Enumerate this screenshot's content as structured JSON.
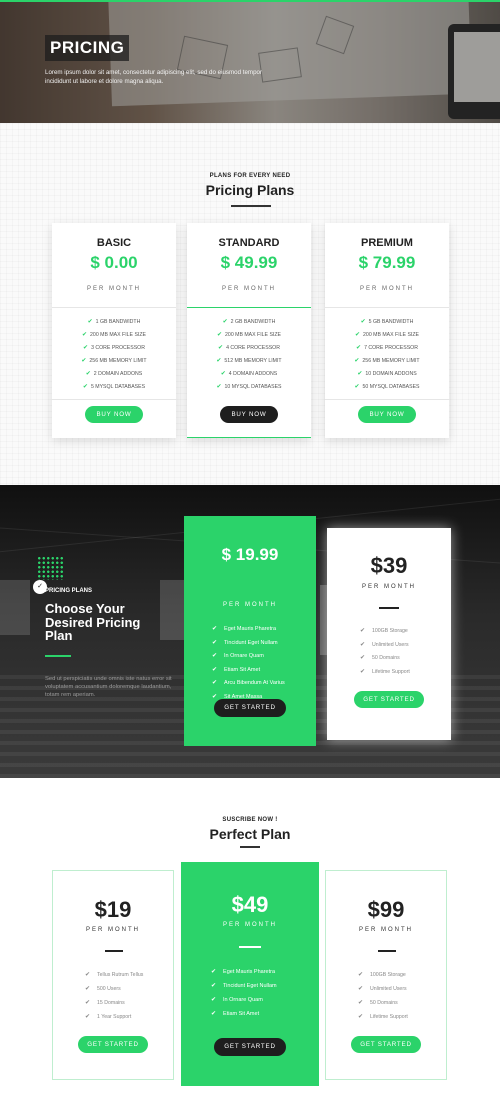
{
  "colors": {
    "accent": "#2bd36a",
    "dark": "#1e1e1e"
  },
  "hero": {
    "title": "PRICING",
    "subtitle": "Lorem ipsum dolor sit amet, consectetur adipiscing elit, sed do eiusmod tempor incididunt ut labore et dolore magna aliqua."
  },
  "section1": {
    "kicker": "PLANS FOR EVERY NEED",
    "title": "Pricing Plans",
    "plans": [
      {
        "name": "BASIC",
        "price": "$ 0.00",
        "period": "PER MONTH",
        "features": [
          "1 GB BANDWIDTH",
          "200 MB MAX FILE SIZE",
          "3 CORE PROCESSOR",
          "256 MB MEMORY LIMIT",
          "2 DOMAIN ADDONS",
          "5 MYSQL DATABASES"
        ],
        "button": "BUY NOW"
      },
      {
        "name": "STANDARD",
        "price": "$ 49.99",
        "period": "PER MONTH",
        "features": [
          "2 GB BANDWIDTH",
          "200 MB MAX FILE SIZE",
          "4 CORE PROCESSOR",
          "512 MB MEMORY LIMIT",
          "4 DOMAIN ADDONS",
          "10 MYSQL DATABASES"
        ],
        "button": "BUY NOW"
      },
      {
        "name": "PREMIUM",
        "price": "$ 79.99",
        "period": "PER MONTH",
        "features": [
          "5 GB BANDWIDTH",
          "200 MB MAX FILE SIZE",
          "7 CORE PROCESSOR",
          "256 MB MEMORY LIMIT",
          "10 DOMAIN ADDONS",
          "50 MYSQL DATABASES"
        ],
        "button": "BUY NOW"
      }
    ]
  },
  "section2": {
    "kicker": "PRICING PLANS",
    "circle_glyph": "✓",
    "title": "Choose Your Desired Pricing Plan",
    "text": "Sed ut perspiciatis unde omnis iste natus error sit voluptatem accusantium doloremque laudantium, totam rem aperiam.",
    "green_plan": {
      "price": "$ 19.99",
      "period": "PER MONTH",
      "features": [
        "Eget Mauris Pharetra",
        "Tincidunt Eget Nullam",
        "In Ornare Quam",
        "Etiam Sit Amet",
        "Arcu Bibendum At Varius",
        "Sit Amet Massa"
      ],
      "button": "GET STARTED"
    },
    "white_plan": {
      "price": "$39",
      "period": "PER MONTH",
      "features": [
        "100GB Storage",
        "Unlimited Users",
        "50 Domains",
        "Lifetime Support"
      ],
      "button": "GET STARTED"
    }
  },
  "section3": {
    "kicker": "SUSCRIBE NOW !",
    "title": "Perfect Plan",
    "plans": [
      {
        "price": "$19",
        "period": "PER MONTH",
        "features": [
          "Tellus Rutrum Tellus",
          "500 Users",
          "15 Domains",
          "1 Year Support"
        ],
        "button": "GET STARTED"
      },
      {
        "price": "$49",
        "period": "PER MONTH",
        "features": [
          "Eget Mauris Pharetra",
          "Tincidunt Eget Nullam",
          "In Ornare Quam",
          "Etiam Sit Amet"
        ],
        "button": "GET STARTED"
      },
      {
        "price": "$99",
        "period": "PER MONTH",
        "features": [
          "100GB Storage",
          "Unlimited Users",
          "50 Domains",
          "Lifetime Support"
        ],
        "button": "GET STARTED"
      }
    ]
  }
}
